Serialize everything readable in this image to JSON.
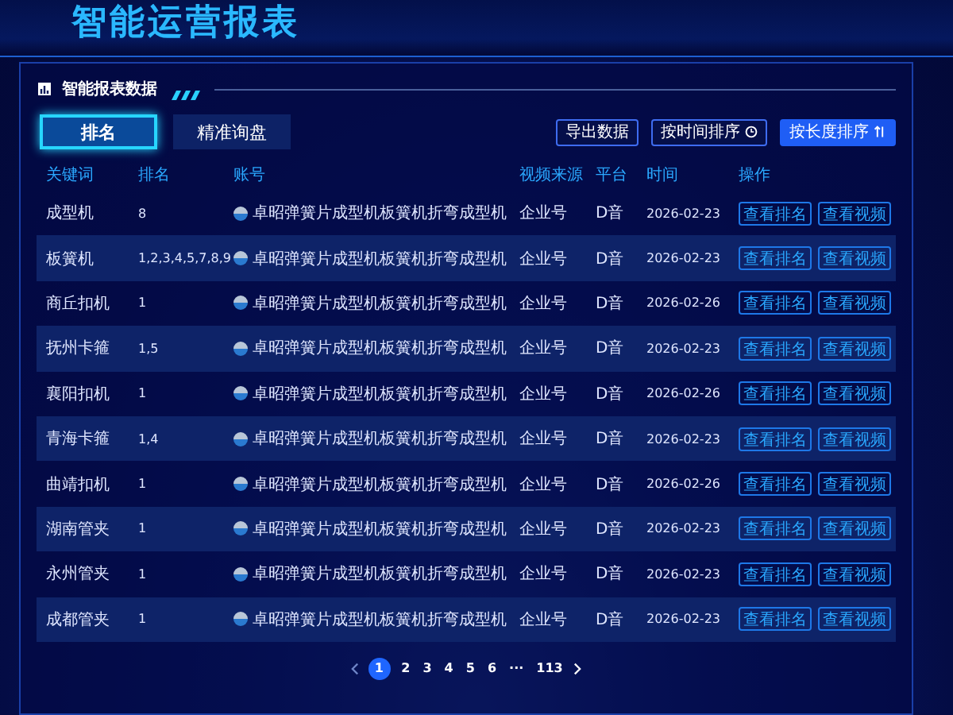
{
  "page_title": "智能运营报表",
  "panel": {
    "title": "智能报表数据",
    "tabs": [
      {
        "label": "排名",
        "selected": true
      },
      {
        "label": "精准询盘",
        "selected": false
      }
    ],
    "actions": [
      {
        "label": "导出数据",
        "kind": "plain"
      },
      {
        "label": "按时间排序",
        "kind": "clock"
      },
      {
        "label": "按长度排序",
        "kind": "sort"
      }
    ],
    "table": {
      "columns": [
        "关键词",
        "排名",
        "账号",
        "视频来源",
        "平台",
        "时间",
        "操作"
      ],
      "rows": [
        {
          "keyword": "成型机",
          "rank": "8",
          "account": "卓昭弹簧片成型机板簧机折弯成型机",
          "source": "企业号",
          "platform": "D音",
          "time": "2026-02-23",
          "buttons": [
            "查看排名",
            "查看视频"
          ]
        },
        {
          "keyword": "板簧机",
          "rank": "1,2,3,4,5,7,8,9",
          "account": "卓昭弹簧片成型机板簧机折弯成型机",
          "source": "企业号",
          "platform": "D音",
          "time": "2026-02-23",
          "buttons": [
            "查看排名",
            "查看视频"
          ]
        },
        {
          "keyword": "商丘扣机",
          "rank": "1",
          "account": "卓昭弹簧片成型机板簧机折弯成型机",
          "source": "企业号",
          "platform": "D音",
          "time": "2026-02-26",
          "buttons": [
            "查看排名",
            "查看视频"
          ]
        },
        {
          "keyword": "抚州卡箍",
          "rank": "1,5",
          "account": "卓昭弹簧片成型机板簧机折弯成型机",
          "source": "企业号",
          "platform": "D音",
          "time": "2026-02-23",
          "buttons": [
            "查看排名",
            "查看视频"
          ]
        },
        {
          "keyword": "襄阳扣机",
          "rank": "1",
          "account": "卓昭弹簧片成型机板簧机折弯成型机",
          "source": "企业号",
          "platform": "D音",
          "time": "2026-02-26",
          "buttons": [
            "查看排名",
            "查看视频"
          ]
        },
        {
          "keyword": "青海卡箍",
          "rank": "1,4",
          "account": "卓昭弹簧片成型机板簧机折弯成型机",
          "source": "企业号",
          "platform": "D音",
          "time": "2026-02-23",
          "buttons": [
            "查看排名",
            "查看视频"
          ]
        },
        {
          "keyword": "曲靖扣机",
          "rank": "1",
          "account": "卓昭弹簧片成型机板簧机折弯成型机",
          "source": "企业号",
          "platform": "D音",
          "time": "2026-02-26",
          "buttons": [
            "查看排名",
            "查看视频"
          ]
        },
        {
          "keyword": "湖南管夹",
          "rank": "1",
          "account": "卓昭弹簧片成型机板簧机折弯成型机",
          "source": "企业号",
          "platform": "D音",
          "time": "2026-02-23",
          "buttons": [
            "查看排名",
            "查看视频"
          ]
        },
        {
          "keyword": "永州管夹",
          "rank": "1",
          "account": "卓昭弹簧片成型机板簧机折弯成型机",
          "source": "企业号",
          "platform": "D音",
          "time": "2026-02-23",
          "buttons": [
            "查看排名",
            "查看视频"
          ]
        },
        {
          "keyword": "成都管夹",
          "rank": "1",
          "account": "卓昭弹簧片成型机板簧机折弯成型机",
          "source": "企业号",
          "platform": "D音",
          "time": "2026-02-23",
          "buttons": [
            "查看排名",
            "查看视频"
          ]
        }
      ]
    },
    "pagination": {
      "pages": [
        {
          "label": "1",
          "selected": true
        },
        {
          "label": "2",
          "selected": false
        },
        {
          "label": "3",
          "selected": false
        },
        {
          "label": "4",
          "selected": false
        },
        {
          "label": "5",
          "selected": false
        },
        {
          "label": "6",
          "selected": false
        }
      ],
      "ellipsis": "···",
      "last": "113"
    }
  }
}
